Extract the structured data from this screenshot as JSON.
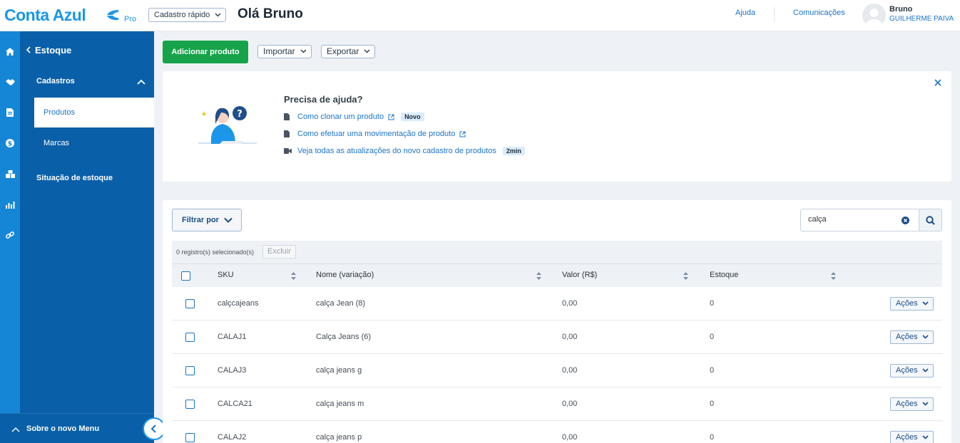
{
  "header": {
    "logo": "Conta Azul",
    "logo_plan": "Pro",
    "quick_register": "Cadastro rápido",
    "greeting": "Olá Bruno",
    "help_link": "Ajuda",
    "comms_link": "Comunicações",
    "user_first": "Bruno",
    "user_last": "GUILHERME PAIVA"
  },
  "rail_icons": [
    "home-icon",
    "handshake-icon",
    "document-icon",
    "money-icon",
    "inventory-icon",
    "reports-icon",
    "integrations-icon"
  ],
  "sidemenu": {
    "back_label": "Estoque",
    "group_label": "Cadastros",
    "items": [
      {
        "label": "Produtos",
        "active": true
      },
      {
        "label": "Marcas",
        "active": false
      }
    ],
    "top_item": "Situação de estoque",
    "footer_label": "Sobre o novo Menu"
  },
  "actions": {
    "add_product": "Adicionar produto",
    "import": "Importar",
    "export": "Exportar"
  },
  "help": {
    "title": "Precisa de ajuda?",
    "links": [
      {
        "text": "Como clonar um produto",
        "badge": "Novo",
        "icon": "document-icon"
      },
      {
        "text": "Como efetuar uma movimentação de produto",
        "badge": "",
        "icon": "document-icon"
      },
      {
        "text": "Veja todas as atualizações do novo cadastro de produtos",
        "badge": "2min",
        "icon": "video-icon"
      }
    ]
  },
  "table": {
    "filter_label": "Filtrar por",
    "search_value": "calça",
    "selection_text": "0 registro(s) selecionado(s)",
    "delete_label": "Excluir",
    "columns": [
      "SKU",
      "Nome (variação)",
      "Valor (R$)",
      "Estoque"
    ],
    "actions_label": "Ações",
    "rows": [
      {
        "sku": "calçcajeans",
        "name": "calça Jean (8)",
        "value": "0,00",
        "stock": "0"
      },
      {
        "sku": "CALAJ1",
        "name": "Calça Jeans (6)",
        "value": "0,00",
        "stock": "0"
      },
      {
        "sku": "CALAJ3",
        "name": "calça jeans g",
        "value": "0,00",
        "stock": "0"
      },
      {
        "sku": "CALCA21",
        "name": "calça jeans m",
        "value": "0,00",
        "stock": "0"
      },
      {
        "sku": "CALAJ2",
        "name": "calça jeans p",
        "value": "0,00",
        "stock": "0"
      }
    ]
  },
  "colors": {
    "brand_blue": "#1b96e8",
    "sidebar_blue": "#0a60a8",
    "rail_blue": "#1585d6",
    "primary_green": "#16a34a",
    "link_blue": "#1b74c9"
  }
}
